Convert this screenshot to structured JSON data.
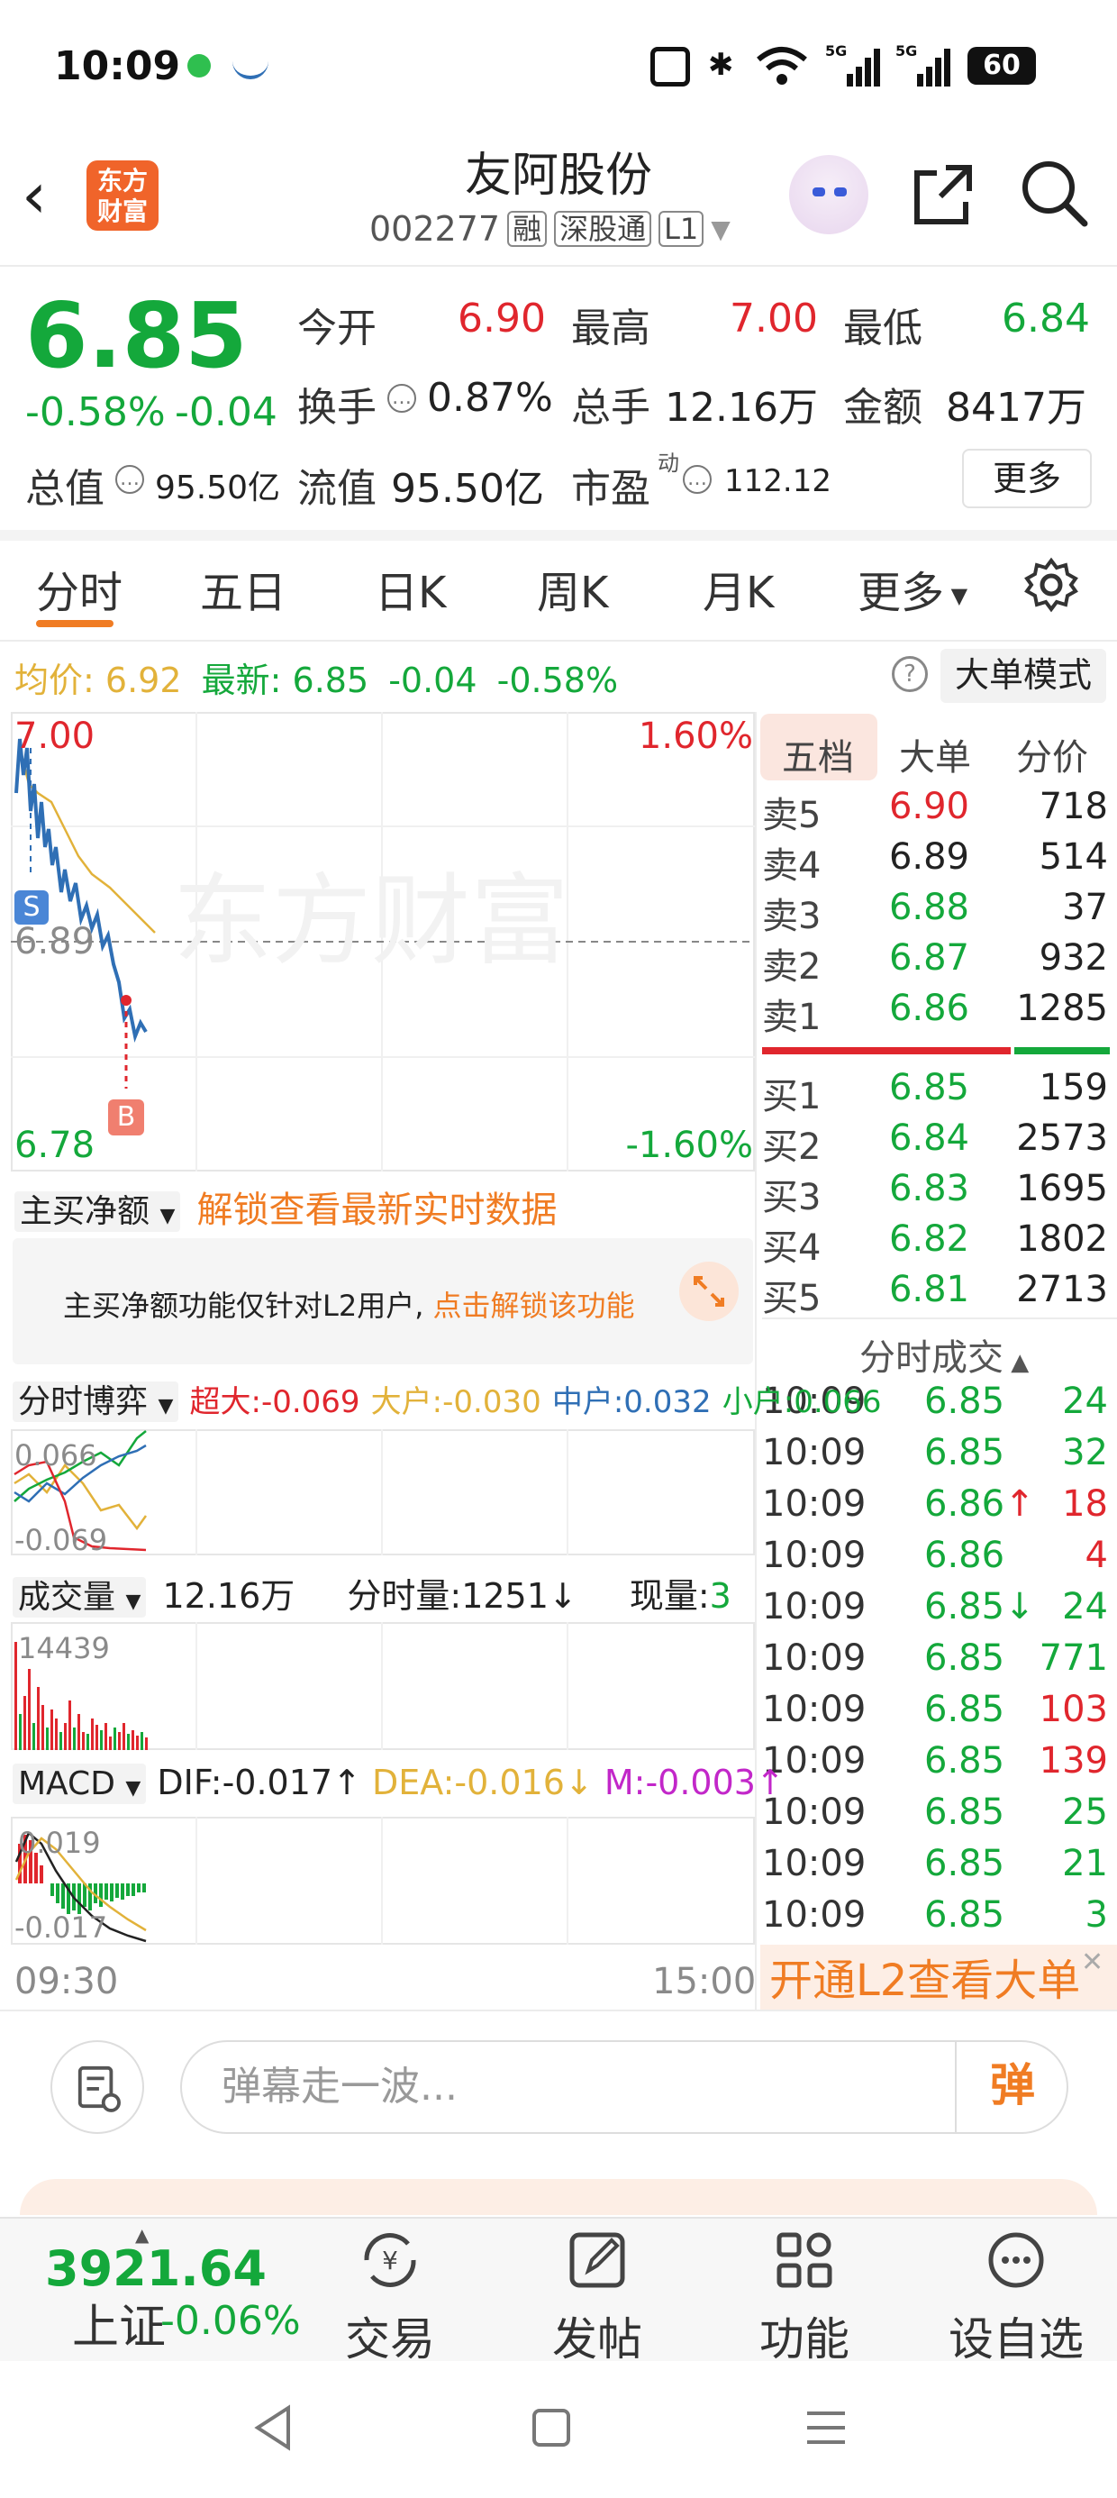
{
  "status_bar": {
    "time": "10:09",
    "battery": "60"
  },
  "header": {
    "logo_line1": "东方",
    "logo_line2": "财富",
    "stock_name": "友阿股份",
    "stock_code": "002277",
    "tags": [
      "融",
      "深股通",
      "L1"
    ]
  },
  "quote": {
    "price": "6.85",
    "change_pct": "-0.58%",
    "change": "-0.04",
    "open_label": "今开",
    "open": "6.90",
    "high_label": "最高",
    "high": "7.00",
    "low_label": "最低",
    "low": "6.84",
    "turnover_label": "换手",
    "turnover": "0.87%",
    "volume_label": "总手",
    "volume": "12.16万",
    "amount_label": "金额",
    "amount": "8417万",
    "mktcap_label": "总值",
    "mktcap": "95.50亿",
    "float_label": "流值",
    "float_cap": "95.50亿",
    "pe_label": "市盈",
    "pe_sup": "动",
    "pe": "112.12",
    "more_label": "更多"
  },
  "tabs": [
    "分时",
    "五日",
    "日K",
    "周K",
    "月K",
    "更多"
  ],
  "avg_row": {
    "avg_label": "均价:",
    "avg": "6.92",
    "latest_label": "最新:",
    "latest": "6.85",
    "latest_chg": "-0.04",
    "latest_pct": "-0.58%",
    "help": "?",
    "mode_label": "大单模式"
  },
  "chart": {
    "watermark": "东方财富",
    "y_top_left": "7.00",
    "y_top_right": "1.60%",
    "y_mid": "6.89",
    "y_bottom_left": "6.78",
    "y_bottom_right": "-1.60%",
    "marker_s": "S",
    "marker_b": "B",
    "time_start": "09:30",
    "time_end": "15:00",
    "colors": {
      "price_line": "#2f6fb5",
      "avg_line": "#e2b23a"
    }
  },
  "orderbook": {
    "tabs": [
      "五档",
      "大单",
      "分价"
    ],
    "sells": [
      {
        "label": "卖5",
        "price": "6.90",
        "vol": "718",
        "color": "#e0262d"
      },
      {
        "label": "卖4",
        "price": "6.89",
        "vol": "514",
        "color": "#222222"
      },
      {
        "label": "卖3",
        "price": "6.88",
        "vol": "37",
        "color": "#14a83b"
      },
      {
        "label": "卖2",
        "price": "6.87",
        "vol": "932",
        "color": "#14a83b"
      },
      {
        "label": "卖1",
        "price": "6.86",
        "vol": "1285",
        "color": "#14a83b"
      }
    ],
    "buys": [
      {
        "label": "买1",
        "price": "6.85",
        "vol": "159",
        "color": "#14a83b"
      },
      {
        "label": "买2",
        "price": "6.84",
        "vol": "2573",
        "color": "#14a83b"
      },
      {
        "label": "买3",
        "price": "6.83",
        "vol": "1695",
        "color": "#14a83b"
      },
      {
        "label": "买4",
        "price": "6.82",
        "vol": "1802",
        "color": "#14a83b"
      },
      {
        "label": "买5",
        "price": "6.81",
        "vol": "2713",
        "color": "#14a83b"
      }
    ]
  },
  "trades": {
    "title": "分时成交",
    "rows": [
      {
        "time": "10:09",
        "price": "6.85",
        "vol": "24",
        "vol_color": "#14a83b"
      },
      {
        "time": "10:09",
        "price": "6.85",
        "vol": "32",
        "vol_color": "#14a83b"
      },
      {
        "time": "10:09",
        "price": "6.86↑",
        "vol": "18",
        "vol_color": "#e0262d"
      },
      {
        "time": "10:09",
        "price": "6.86",
        "vol": "4",
        "vol_color": "#e0262d"
      },
      {
        "time": "10:09",
        "price": "6.85↓",
        "vol": "24",
        "vol_color": "#14a83b"
      },
      {
        "time": "10:09",
        "price": "6.85",
        "vol": "771",
        "vol_color": "#14a83b"
      },
      {
        "time": "10:09",
        "price": "6.85",
        "vol": "103",
        "vol_color": "#e0262d"
      },
      {
        "time": "10:09",
        "price": "6.85",
        "vol": "139",
        "vol_color": "#e0262d"
      },
      {
        "time": "10:09",
        "price": "6.85",
        "vol": "25",
        "vol_color": "#14a83b"
      },
      {
        "time": "10:09",
        "price": "6.85",
        "vol": "21",
        "vol_color": "#14a83b"
      },
      {
        "time": "10:09",
        "price": "6.85",
        "vol": "3",
        "vol_color": "#14a83b"
      }
    ],
    "l2_banner": "开通L2查看大单"
  },
  "net_buy": {
    "dropdown": "主买净额",
    "unlock_link": "解锁查看最新实时数据",
    "notice": "主买净额功能仅针对L2用户,",
    "notice_link": "点击解锁该功能"
  },
  "game": {
    "dropdown": "分时博弈",
    "super_label": "超大:",
    "super": "-0.069",
    "large_label": "大户:",
    "large": "-0.030",
    "mid_label": "中户:",
    "mid": "0.032",
    "small_label": "小户:",
    "small": "0.066",
    "y_top": "0.066",
    "y_bottom": "-0.069"
  },
  "volume": {
    "dropdown": "成交量",
    "total": "12.16万",
    "minute_label": "分时量:",
    "minute": "1251↓",
    "current_label": "现量:",
    "current": "3",
    "y_top": "14439"
  },
  "macd": {
    "dropdown": "MACD",
    "dif_label": "DIF:",
    "dif": "-0.017↑",
    "dea_label": "DEA:",
    "dea": "-0.016↓",
    "m_label": "M:",
    "m": "-0.003↑",
    "y_top": "0.019",
    "y_bottom": "-0.017"
  },
  "danmaku": {
    "placeholder": "弹幕走一波...",
    "send": "弹"
  },
  "bottom_bar": {
    "index_value": "3921.64",
    "index_name": "上证",
    "index_change": "-0.06%",
    "items": [
      "交易",
      "发帖",
      "功能",
      "设自选"
    ]
  }
}
